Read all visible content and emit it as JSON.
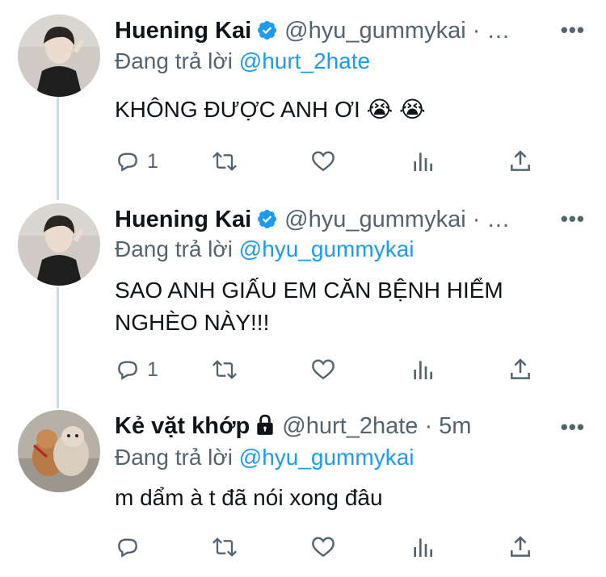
{
  "tweets": [
    {
      "name": "Huening Kai",
      "handle": "@hyu_gummykai",
      "time": "·",
      "more": "•••",
      "reply_prefix": "Đang trả lời",
      "reply_mention": "@hurt_2hate",
      "text": "KHÔNG ĐƯỢC ANH ƠI 😭 😭",
      "reply_count": "1"
    },
    {
      "name": "Huening Kai",
      "handle": "@hyu_gummykai",
      "time": "·",
      "more": "•••",
      "reply_prefix": "Đang trả lời",
      "reply_mention": "@hyu_gummykai",
      "text": "SAO ANH GIẤU EM CĂN BỆNH HIỂM NGHÈO NÀY!!!",
      "reply_count": "1"
    },
    {
      "name": "Kẻ vặt khớp",
      "handle": "@hurt_2hate",
      "time": "· 5m",
      "more": "•••",
      "reply_prefix": "Đang trả lời",
      "reply_mention": "@hyu_gummykai",
      "text": "m dẩm à t đã nói xong đâu",
      "reply_count": ""
    }
  ],
  "icons": [
    "reply-icon",
    "retweet-icon",
    "like-icon",
    "analytics-icon",
    "share-icon",
    "verified-badge-icon",
    "lock-icon",
    "more-icon"
  ],
  "colors": {
    "verified": "#1d9bf0",
    "mention": "#1d9bf0",
    "muted": "#536471",
    "thread_line": "#cfd9de"
  }
}
